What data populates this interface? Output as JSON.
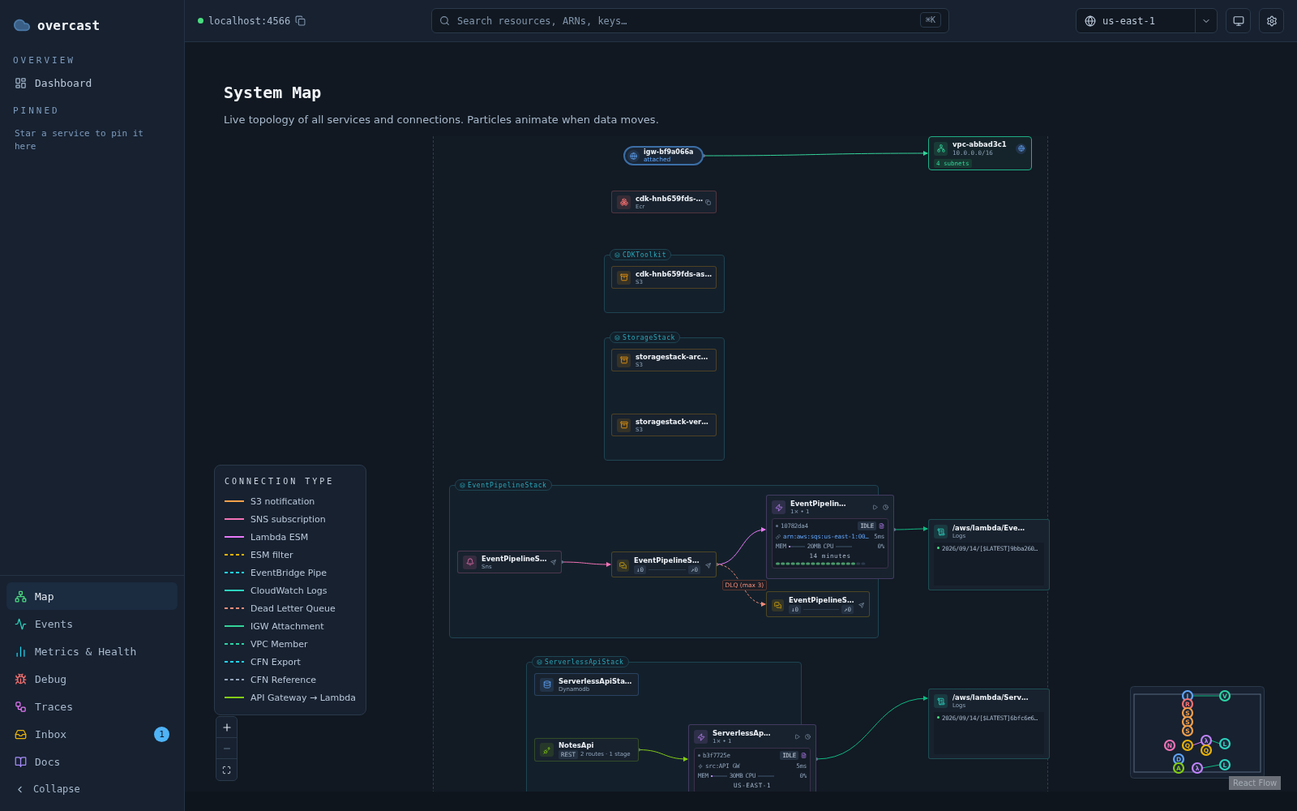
{
  "brand": "overcast",
  "sidebar": {
    "sections": [
      {
        "title": "OVERVIEW",
        "items": [
          {
            "label": "Dashboard"
          }
        ]
      },
      {
        "title": "PINNED",
        "note": "Star a service to pin it here"
      }
    ],
    "nav": [
      {
        "label": "Map",
        "selected": true
      },
      {
        "label": "Events",
        "selected": false
      },
      {
        "label": "Metrics & Health",
        "selected": false
      },
      {
        "label": "Debug",
        "selected": false
      },
      {
        "label": "Traces",
        "selected": false
      },
      {
        "label": "Inbox",
        "selected": false,
        "badge": "1"
      },
      {
        "label": "Docs",
        "selected": false
      }
    ],
    "collapse": "Collapse"
  },
  "topbar": {
    "endpoint": "localhost:4566",
    "search": {
      "placeholder": "Search resources, ARNs, keys…",
      "shortcut": "⌘K"
    },
    "region": "us-east-1"
  },
  "page": {
    "title": "System Map",
    "subtitle": "Live topology of all services and connections. Particles animate when data moves."
  },
  "groups": [
    {
      "label": "CDKToolkit"
    },
    {
      "label": "StorageStack"
    },
    {
      "label": "EventPipelineStack"
    },
    {
      "label": "ServerlessApiStack"
    }
  ],
  "nodes": [
    {
      "kind": "igw",
      "name": "igw-bf9a066a",
      "sub": "attached"
    },
    {
      "kind": "vpc",
      "name": "vpc-abbad3c1",
      "sub": "10.0.0.0/16",
      "tag": "4 subnets"
    },
    {
      "kind": "ecr",
      "name": "cdk-hnb659fds-…",
      "sub": "Ecr"
    },
    {
      "kind": "s3",
      "name": "cdk-hnb659fds-as…",
      "sub": "S3"
    },
    {
      "kind": "s3",
      "name": "storagestack-arc…",
      "sub": "S3"
    },
    {
      "kind": "s3",
      "name": "storagestack-ver…",
      "sub": "S3"
    },
    {
      "kind": "sns",
      "name": "EventPipelineS…",
      "sub": "Sns"
    },
    {
      "kind": "sqs",
      "name": "EventPipelineS…",
      "counters": [
        "↓0",
        "↗0"
      ]
    },
    {
      "kind": "lambda",
      "name": "EventPipelin…",
      "sub": "1× • 1",
      "id": "10782da4",
      "status": "IDLE",
      "source": {
        "kind": "arn",
        "text": "arn:aws:sqs:us-east-1:00…"
      },
      "duration": "5ms",
      "memory": {
        "label": "MEM",
        "reading": "20MB",
        "level": 0.1
      },
      "cpu": {
        "label": "CPU",
        "reading": "0%"
      },
      "age": "14 minutes"
    },
    {
      "kind": "sqs",
      "name": "EventPipelineS…",
      "counters": [
        "↓0",
        "↗0"
      ]
    },
    {
      "kind": "logs",
      "name": "/aws/lambda/Eve…",
      "sub": "Logs",
      "line": "2026/09/14/[$LATEST]9bba260…"
    },
    {
      "kind": "dynamodb",
      "name": "ServerlessApiSta…",
      "sub": "Dynamodb"
    },
    {
      "kind": "apigw",
      "name": "NotesApi",
      "tag": "REST",
      "sub": "2 routes · 1 stage"
    },
    {
      "kind": "lambda",
      "name": "ServerlessAp…",
      "sub": "1× • 1",
      "id": "b3f7725e",
      "status": "IDLE",
      "source": {
        "kind": "trigger",
        "text": "src:API GW"
      },
      "duration": "5ms",
      "memory": {
        "label": "MEM",
        "reading": "30MB",
        "level": 0.1
      },
      "cpu": {
        "label": "CPU",
        "reading": "0%"
      },
      "overlay": "US-EAST-1"
    },
    {
      "kind": "logs",
      "name": "/aws/lambda/Serv…",
      "sub": "Logs",
      "line": "2026/09/14/[$LATEST]6bfc6e6…"
    }
  ],
  "edge_labels": [
    {
      "text": "DLQ (max 3)"
    }
  ],
  "legend": {
    "title": "CONNECTION TYPE",
    "items": [
      {
        "label": "S3 notification",
        "color": "#f5a04a",
        "dashed": false
      },
      {
        "label": "SNS subscription",
        "color": "#f472b6",
        "dashed": false
      },
      {
        "label": "Lambda ESM",
        "color": "#e879f9",
        "dashed": false
      },
      {
        "label": "ESM filter",
        "color": "#eab308",
        "dashed": true
      },
      {
        "label": "EventBridge Pipe",
        "color": "#22d3ee",
        "dashed": true
      },
      {
        "label": "CloudWatch Logs",
        "color": "#2dd4bf",
        "dashed": false
      },
      {
        "label": "Dead Letter Queue",
        "color": "#f08c7a",
        "dashed": true
      },
      {
        "label": "IGW Attachment",
        "color": "#34d399",
        "dashed": false
      },
      {
        "label": "VPC Member",
        "color": "#2dd4a4",
        "dashed": true
      },
      {
        "label": "CFN Export",
        "color": "#22d3ee",
        "dashed": true
      },
      {
        "label": "CFN Reference",
        "color": "#94a3b8",
        "dashed": true
      },
      {
        "label": "API Gateway → Lambda",
        "color": "#84cc16",
        "dashed": false
      }
    ]
  },
  "minimap": {
    "markers": [
      {
        "letter": "I",
        "color": "#60a5fa"
      },
      {
        "letter": "V",
        "color": "#2dd4a4"
      },
      {
        "letter": "R",
        "color": "#f87171"
      },
      {
        "letter": "S",
        "color": "#f5a04a"
      },
      {
        "letter": "S",
        "color": "#f5a04a"
      },
      {
        "letter": "S",
        "color": "#f5a04a"
      },
      {
        "letter": "N",
        "color": "#f472b6"
      },
      {
        "letter": "Q",
        "color": "#eab308"
      },
      {
        "letter": "λ",
        "color": "#c084fc"
      },
      {
        "letter": "Q",
        "color": "#eab308"
      },
      {
        "letter": "L",
        "color": "#2dd4bf"
      },
      {
        "letter": "D",
        "color": "#60a5fa"
      },
      {
        "letter": "A",
        "color": "#84cc16"
      },
      {
        "letter": "λ",
        "color": "#c084fc"
      },
      {
        "letter": "L",
        "color": "#2dd4bf"
      }
    ],
    "attribution": "React Flow"
  }
}
